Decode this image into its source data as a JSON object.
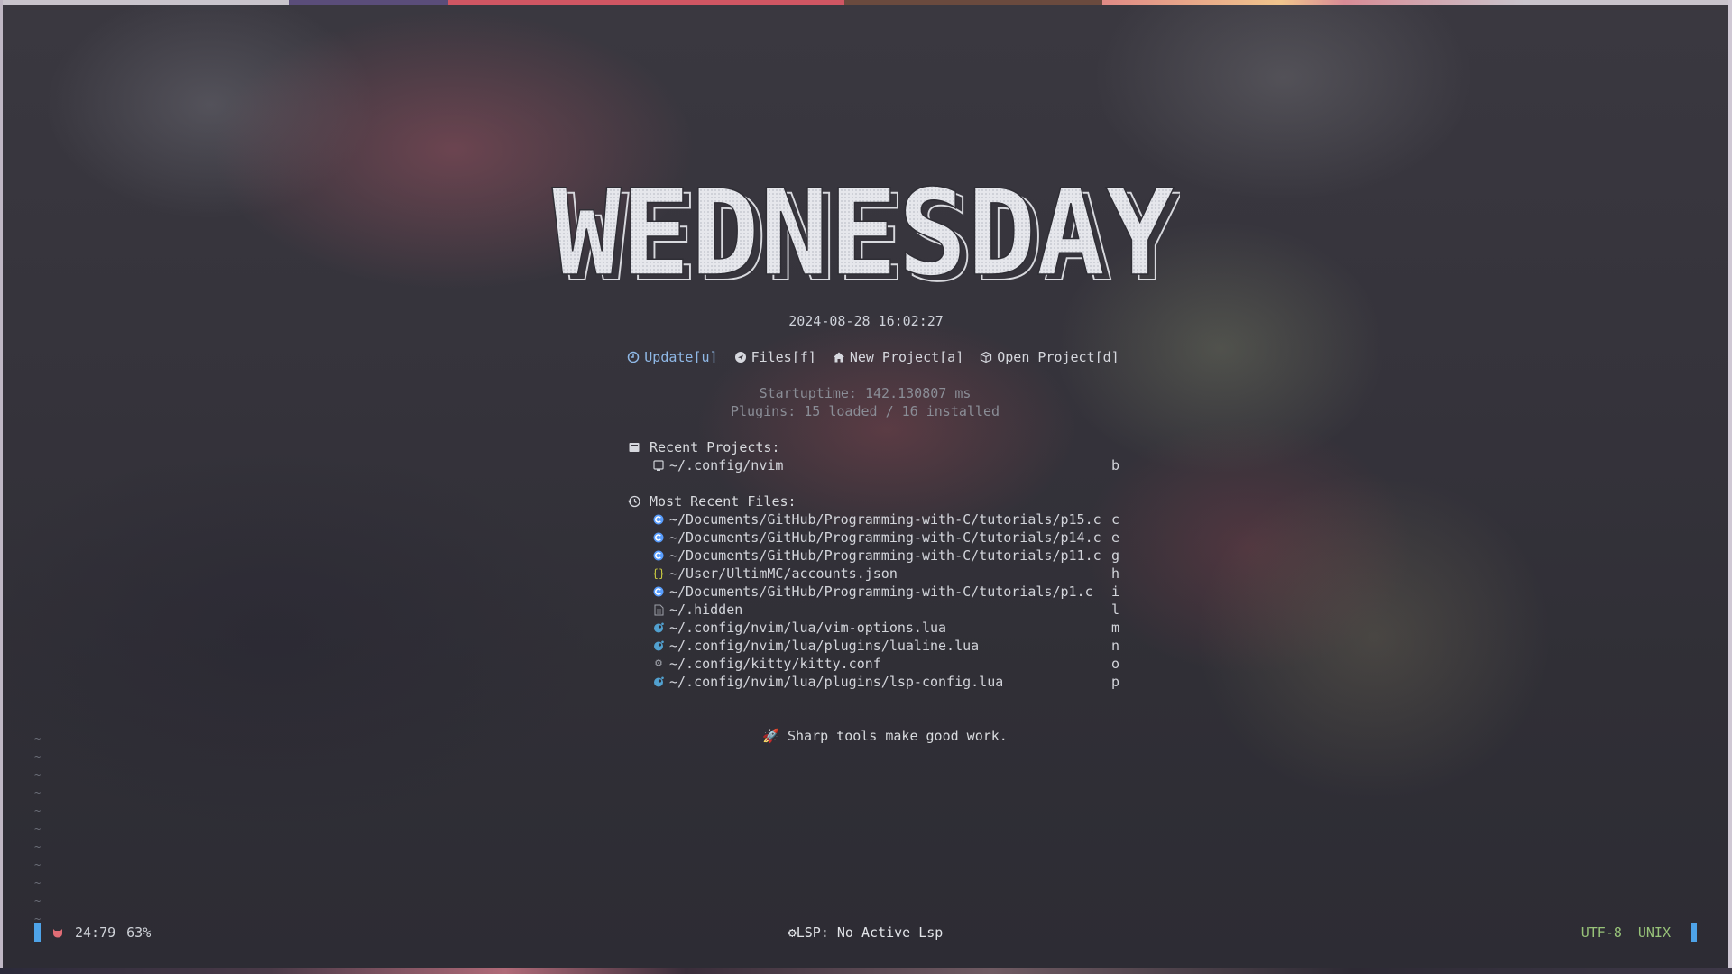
{
  "dashboard": {
    "header_text": "WEDNESDAY",
    "datetime": "2024-08-28 16:02:27",
    "actions": [
      {
        "label": "Update[u]",
        "icon": "update-icon"
      },
      {
        "label": "Files[f]",
        "icon": "files-icon"
      },
      {
        "label": "New Project[a]",
        "icon": "home-icon"
      },
      {
        "label": "Open Project[d]",
        "icon": "package-icon"
      }
    ],
    "startuptime": "Startuptime: 142.130807 ms",
    "plugins": "Plugins: 15 loaded / 16 installed",
    "recent_projects": {
      "title": "Recent Projects:",
      "items": [
        {
          "path": "~/.config/nvim",
          "key": "b",
          "icon": "folder-icon"
        }
      ]
    },
    "recent_files": {
      "title": "Most Recent Files:",
      "items": [
        {
          "path": "~/Documents/GitHub/Programming-with-C/tutorials/p15.c",
          "key": "c",
          "icon": "c-file-icon"
        },
        {
          "path": "~/Documents/GitHub/Programming-with-C/tutorials/p14.c",
          "key": "e",
          "icon": "c-file-icon"
        },
        {
          "path": "~/Documents/GitHub/Programming-with-C/tutorials/p11.c",
          "key": "g",
          "icon": "c-file-icon"
        },
        {
          "path": "~/User/UltimMC/accounts.json",
          "key": "h",
          "icon": "json-file-icon"
        },
        {
          "path": "~/Documents/GitHub/Programming-with-C/tutorials/p1.c",
          "key": "i",
          "icon": "c-file-icon"
        },
        {
          "path": "~/.hidden",
          "key": "l",
          "icon": "text-file-icon"
        },
        {
          "path": "~/.config/nvim/lua/vim-options.lua",
          "key": "m",
          "icon": "lua-file-icon"
        },
        {
          "path": "~/.config/nvim/lua/plugins/lualine.lua",
          "key": "n",
          "icon": "lua-file-icon"
        },
        {
          "path": "~/.config/kitty/kitty.conf",
          "key": "o",
          "icon": "gear-icon"
        },
        {
          "path": "~/.config/nvim/lua/plugins/lsp-config.lua",
          "key": "p",
          "icon": "lua-file-icon"
        }
      ]
    },
    "quote": "Sharp tools make good work."
  },
  "statusline": {
    "position": "24:79",
    "percent": "63%",
    "lsp": "LSP: No Active Lsp",
    "encoding": "UTF-8",
    "format": "UNIX"
  },
  "colors": {
    "accent_blue": "#4ea3e8",
    "update_blue": "#8fb8e6",
    "status_green": "#98c379",
    "mode_red": "#e06c75",
    "c_icon": "#599eff",
    "json_icon": "#cbcb41",
    "lua_icon": "#51a0cf"
  }
}
